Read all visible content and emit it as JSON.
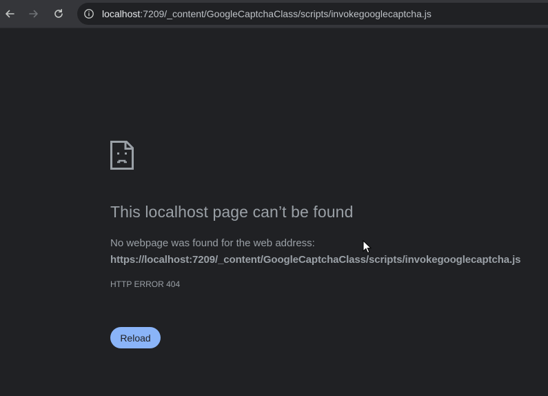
{
  "browser": {
    "url_host": "localhost",
    "url_path": ":7209/_content/GoogleCaptchaClass/scripts/invokegooglecaptcha.js",
    "icons": {
      "back": "arrow-left-icon",
      "forward": "arrow-right-icon",
      "reload": "reload-icon",
      "site_info": "info-circle-icon"
    }
  },
  "error_page": {
    "title": "This localhost page can’t be found",
    "description": "No webpage was found for the web address:",
    "url": "https://localhost:7209/_content/GoogleCaptchaClass/scripts/invokegooglecaptcha.js",
    "error_code": "HTTP ERROR 404",
    "reload_label": "Reload"
  },
  "colors": {
    "background": "#202124",
    "toolbar": "#35363a",
    "text": "#9aa0a6",
    "button": "#8ab4f8"
  }
}
